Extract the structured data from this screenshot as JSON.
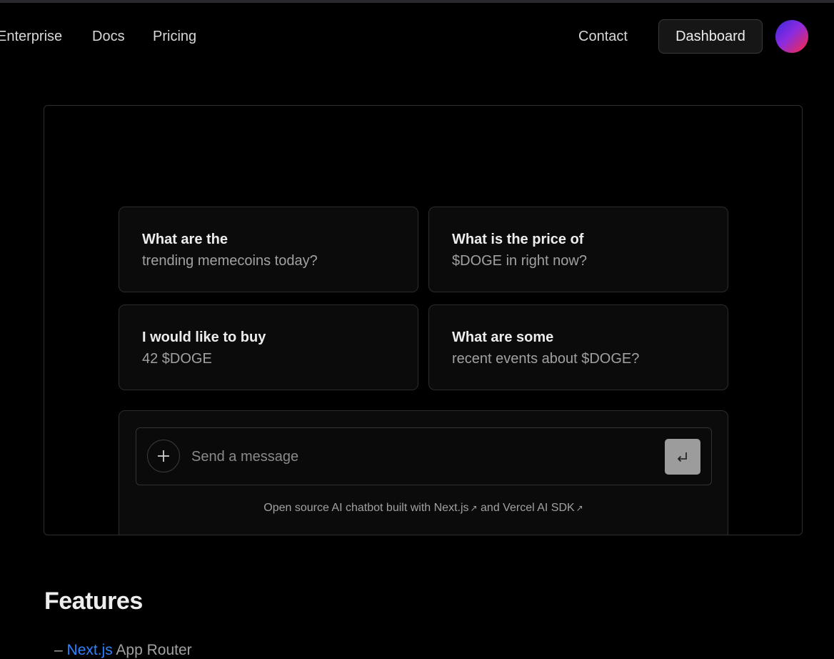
{
  "nav": {
    "links": [
      {
        "label": "Enterprise"
      },
      {
        "label": "Docs"
      },
      {
        "label": "Pricing"
      }
    ],
    "contact_label": "Contact",
    "dashboard_label": "Dashboard"
  },
  "chat": {
    "suggestions": [
      {
        "title": "What are the",
        "subtitle": "trending memecoins today?"
      },
      {
        "title": "What is the price of",
        "subtitle": "$DOGE in right now?"
      },
      {
        "title": "I would like to buy",
        "subtitle": "42 $DOGE"
      },
      {
        "title": "What are some",
        "subtitle": "recent events about $DOGE?"
      }
    ],
    "input": {
      "placeholder": "Send a message",
      "value": ""
    },
    "footer": {
      "prefix": "Open source AI chatbot built with ",
      "link1": "Next.js",
      "middle": " and ",
      "link2": "Vercel AI SDK",
      "arrow": "↗"
    },
    "icons": {
      "add": "plus-icon",
      "send": "enter-return-icon"
    }
  },
  "features": {
    "heading": "Features",
    "items": [
      {
        "bullet": "–",
        "link": "Next.js",
        "text": " App Router"
      }
    ]
  },
  "colors": {
    "background": "#000000",
    "link_blue": "#2f82ff",
    "send_button": "#9c9c9c"
  }
}
